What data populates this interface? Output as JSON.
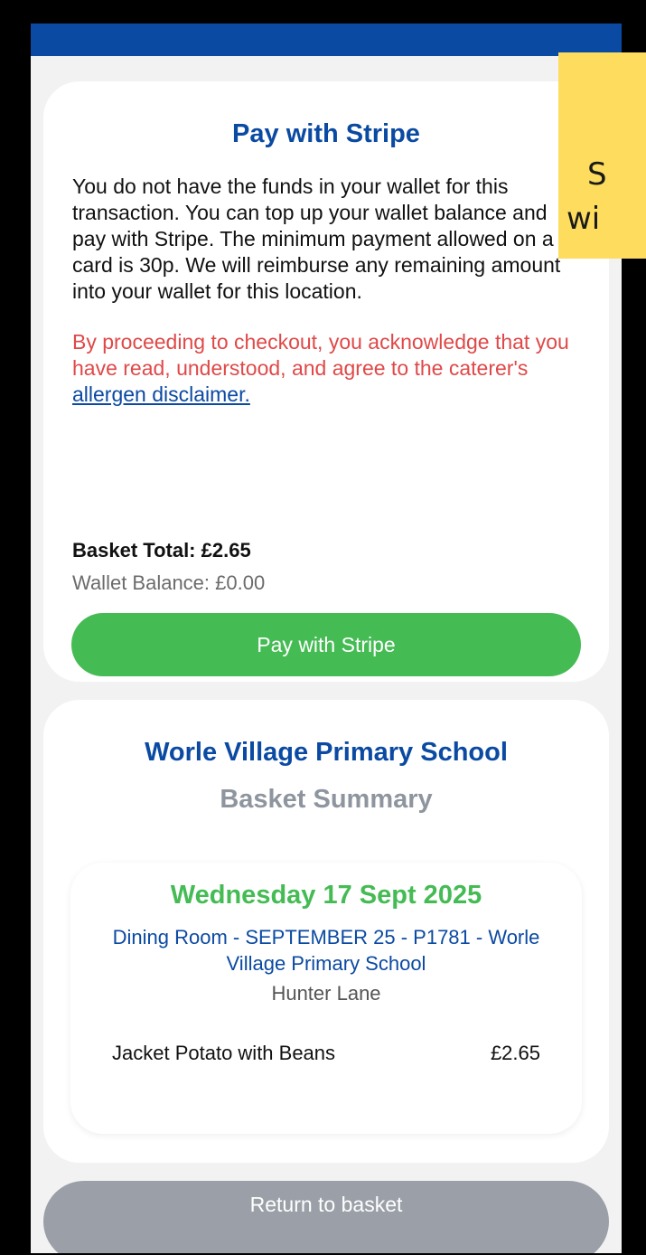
{
  "stripe_panel": {
    "title": "Pay with Stripe",
    "info_text": "You do not have the funds in your wallet for this transaction. You can top up your wallet balance and pay with Stripe. The minimum payment allowed on a card is 30p. We will reimburse any remaining amount into your wallet for this location.",
    "disclaimer_prefix": "By proceeding to checkout, you acknowledge that you have read, understood, and agree to the caterer's ",
    "disclaimer_link": "allergen disclaimer.",
    "basket_total": "Basket Total: £2.65",
    "wallet_balance": "Wallet Balance: £0.00",
    "pay_button_label": "Pay with Stripe"
  },
  "summary_panel": {
    "school_name": "Worle Village Primary School",
    "title": "Basket Summary",
    "day": {
      "date": "Wednesday 17 Sept 2025",
      "location": "Dining Room - SEPTEMBER 25 - P1781 - Worle Village Primary School",
      "sublocation": "Hunter Lane",
      "items": [
        {
          "name": "Jacket Potato with Beans",
          "price": "£2.65"
        }
      ]
    }
  },
  "return_button_label": "Return to basket",
  "overlay": {
    "line1": "S",
    "line2": "wi"
  },
  "colors": {
    "brand_blue": "#0b4aa2",
    "pay_green": "#45bb54",
    "warning_red": "#e04848",
    "overlay_yellow": "#fedd5e"
  }
}
